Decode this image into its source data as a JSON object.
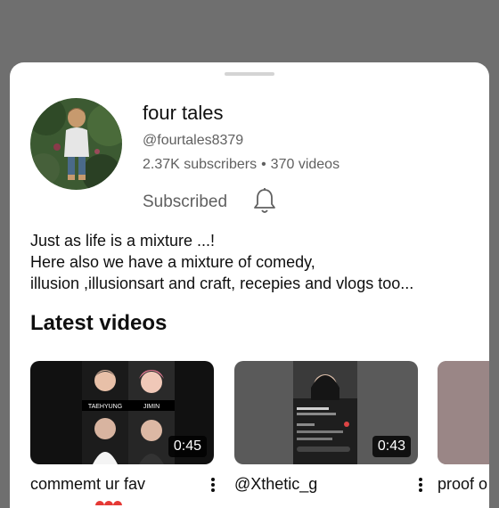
{
  "channel": {
    "name": "four tales",
    "handle": "@fourtales8379",
    "subscribers": "2.37K subscribers",
    "separator": "•",
    "videos": "370 videos",
    "subscribe_label": "Subscribed",
    "notification_icon": "bell-icon"
  },
  "description": {
    "lines": [
      "Just as  life is a mixture ...!",
      "Here  also we have a mixture of comedy,",
      "illusion ,illusionsart and craft, recepies and vlogs too..."
    ]
  },
  "latest": {
    "title": "Latest videos",
    "videos": [
      {
        "title": "commemt ur fav",
        "duration": "0:45",
        "labels": [
          "TAEHYUNG",
          "JIMIN"
        ]
      },
      {
        "title": "@Xthetic_g",
        "duration": "0:43"
      },
      {
        "title": "proof o"
      }
    ]
  },
  "colors": {
    "overlay": "#6f6f6f",
    "sheet": "#ffffff",
    "secondary_text": "#606060"
  }
}
